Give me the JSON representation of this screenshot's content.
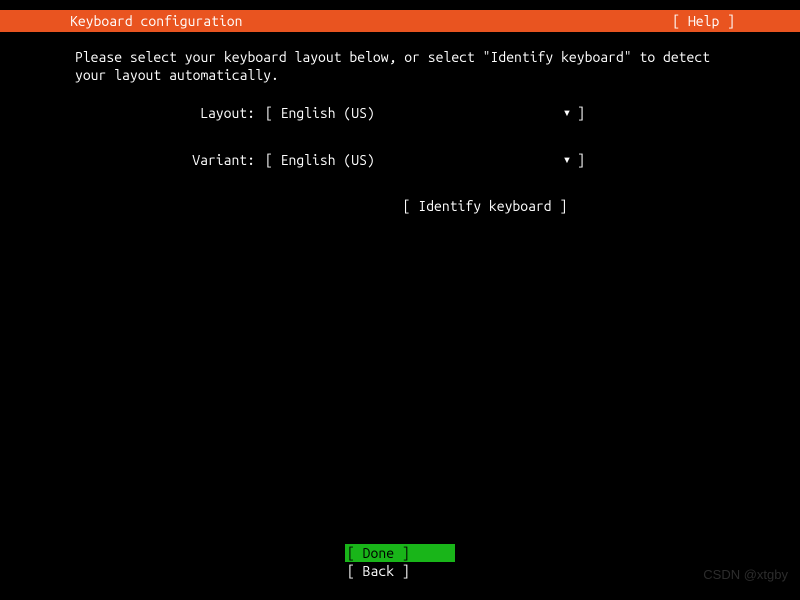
{
  "header": {
    "title": "Keyboard configuration",
    "help": "[ Help ]"
  },
  "instruction": "Please select your keyboard layout below, or select \"Identify keyboard\" to detect your layout automatically.",
  "form": {
    "layout": {
      "label": "Layout:",
      "value": "[ English (US)",
      "arrow": "▾",
      "close": "]"
    },
    "variant": {
      "label": "Variant:",
      "value": "[ English (US)",
      "arrow": "▾",
      "close": "]"
    }
  },
  "identify": "[ Identify keyboard ]",
  "footer": {
    "done": "[ Done       ]",
    "back": "[ Back       ]"
  },
  "watermark": "CSDN @xtgby"
}
